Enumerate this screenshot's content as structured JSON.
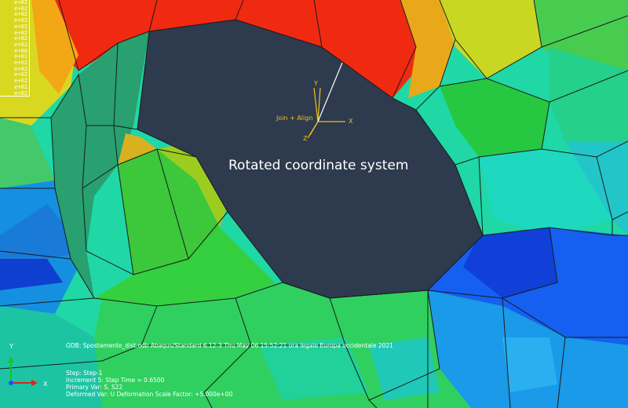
{
  "legend": {
    "entries": [
      "e+02",
      "e+02",
      "e+02",
      "e+02",
      "e+02",
      "e+02",
      "e+02",
      "e+02",
      "e+00",
      "e+01",
      "e+02",
      "e+02",
      "e+02",
      "e+02",
      "e+02",
      "e+02"
    ]
  },
  "viewport": {
    "caption": "Rotated coordinate system"
  },
  "csys": {
    "name": "Join + Align",
    "x_label": "X",
    "y_label": "Y",
    "z_label": "Z",
    "color": "#f2c21a"
  },
  "info": {
    "text": "ODB: Spostamento_dist.odb    Abaqus/Standard 6.12-3    Thu May 06 15:52:21 ora legale Europa occidentale 2021"
  },
  "step_info": {
    "step": "Step: Step-1",
    "increment": "Increment     5: Step Time =    0.6500",
    "primary_var": "Primary Var: S, S22",
    "deformed_var": "Deformed Var: U   Deformation Scale Factor: +5.000e+00"
  },
  "triad": {
    "x_label": "X",
    "y_label": "Y",
    "x_color": "#e02020",
    "y_color": "#20c020",
    "z_color": "#2050ff"
  }
}
